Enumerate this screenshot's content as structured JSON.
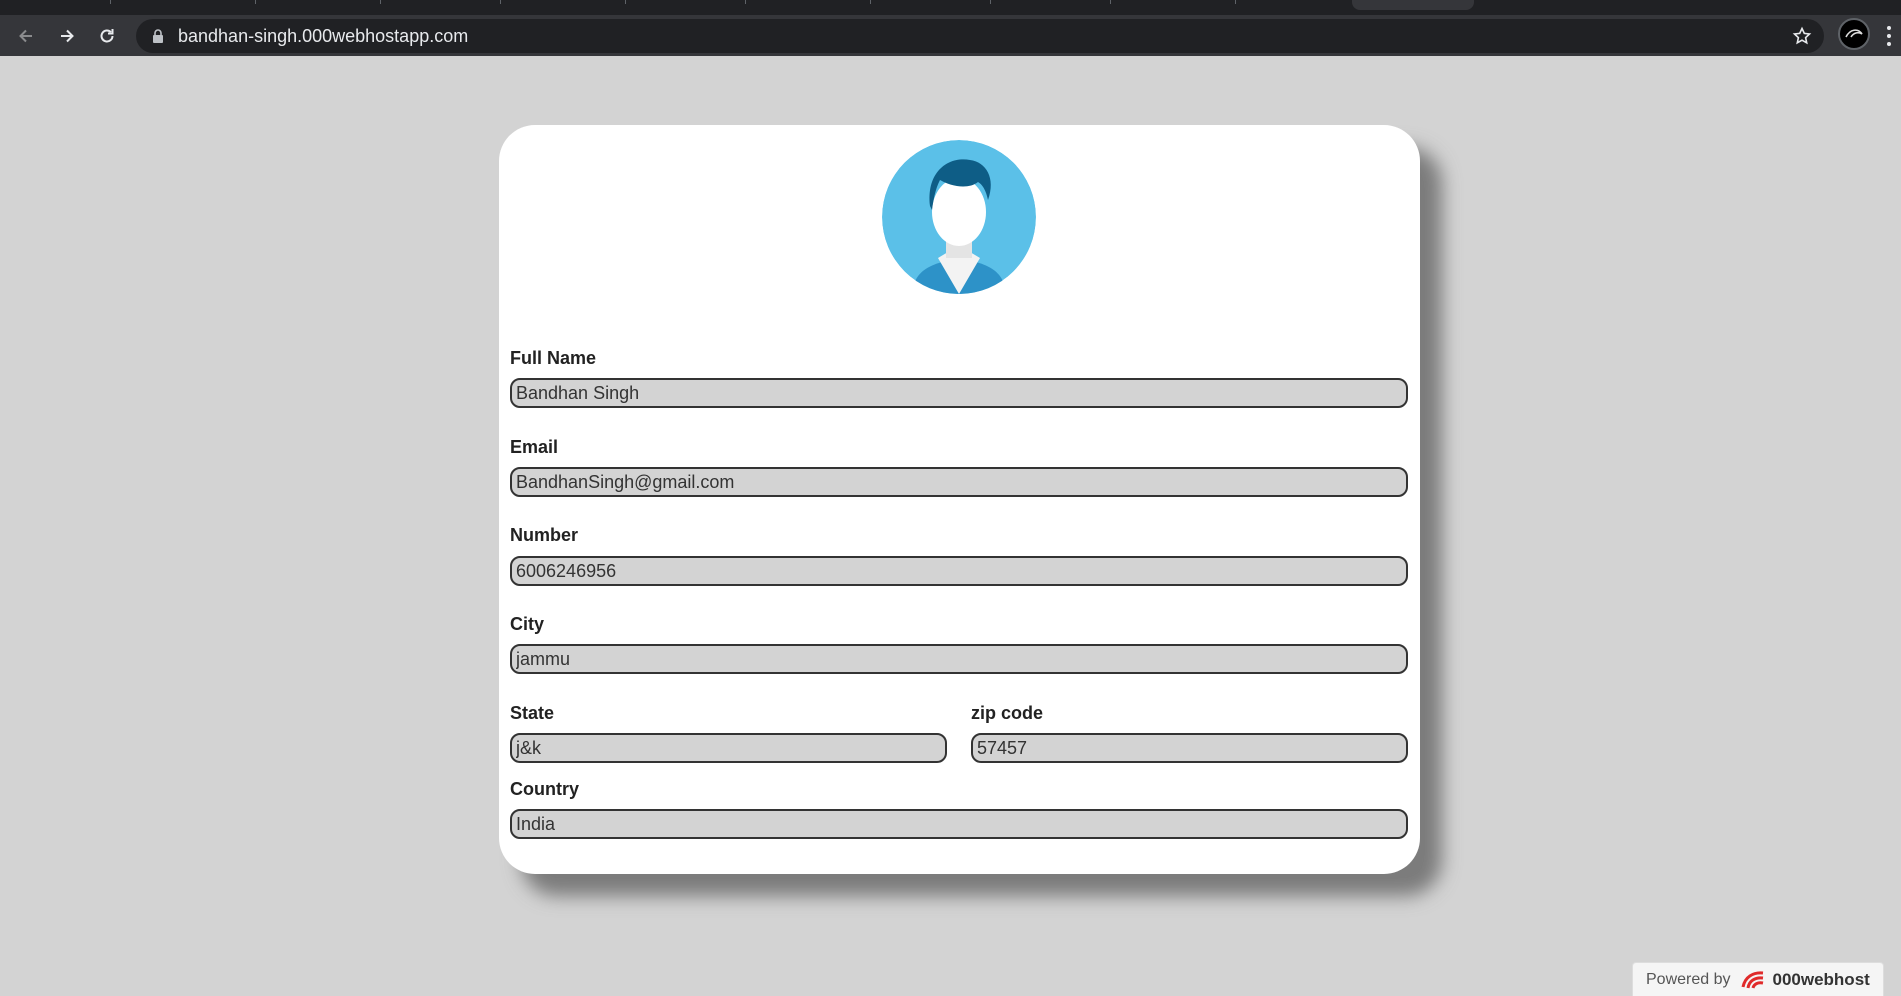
{
  "browser": {
    "url": "bandhan-singh.000webhostapp.com"
  },
  "form": {
    "full_name": {
      "label": "Full Name",
      "value": "Bandhan Singh"
    },
    "email": {
      "label": "Email",
      "value": "BandhanSingh@gmail.com"
    },
    "number": {
      "label": "Number",
      "value": "6006246956"
    },
    "city": {
      "label": "City",
      "value": "jammu"
    },
    "state": {
      "label": "State",
      "value": "j&k"
    },
    "zip": {
      "label": "zip code",
      "value": "57457"
    },
    "country": {
      "label": "Country",
      "value": "India"
    }
  },
  "footer": {
    "powered_by": "Powered by",
    "brand": "000webhost"
  },
  "colors": {
    "page_bg": "#d3d3d3",
    "card_bg": "#ffffff",
    "avatar_bg": "#5bc0e8",
    "input_bg": "#d3d3d3"
  },
  "icons": [
    "back-arrow-icon",
    "forward-arrow-icon",
    "reload-icon",
    "lock-icon",
    "star-icon",
    "profile-icon",
    "menu-dots-icon",
    "avatar-icon",
    "webhost-logo-icon"
  ]
}
